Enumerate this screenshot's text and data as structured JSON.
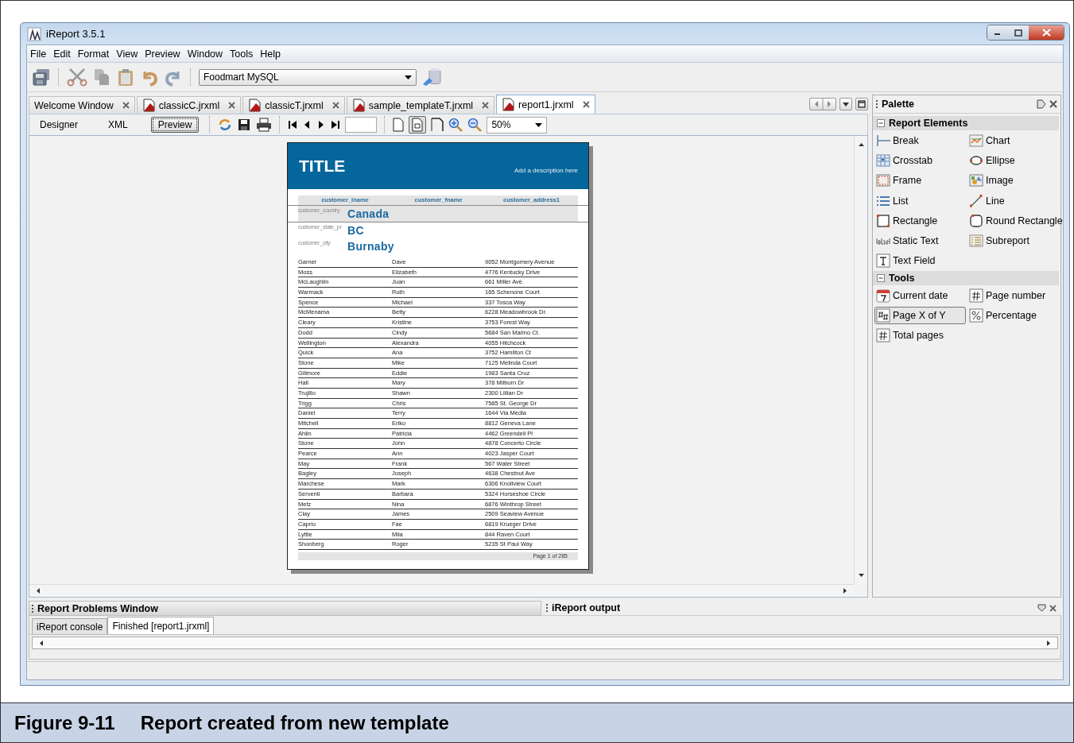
{
  "window": {
    "title": "iReport 3.5.1"
  },
  "menu": [
    "File",
    "Edit",
    "Format",
    "View",
    "Preview",
    "Window",
    "Tools",
    "Help"
  ],
  "toolbar": {
    "datasource": "Foodmart MySQL"
  },
  "editor_tabs": [
    {
      "label": "Welcome Window",
      "kind": "plain",
      "selected": false
    },
    {
      "label": "classicC.jrxml",
      "kind": "report",
      "selected": false
    },
    {
      "label": "classicT.jrxml",
      "kind": "report",
      "selected": false
    },
    {
      "label": "sample_templateT.jrxml",
      "kind": "report",
      "selected": false
    },
    {
      "label": "report1.jrxml",
      "kind": "report",
      "selected": true
    }
  ],
  "view_tabs": [
    {
      "label": "Designer",
      "selected": false
    },
    {
      "label": "XML",
      "selected": false
    },
    {
      "label": "Preview",
      "selected": true
    }
  ],
  "zoom": "50%",
  "report": {
    "title": "TITLE",
    "description": "Add a description here",
    "columns": [
      "customer_lname",
      "customer_fname",
      "customer_address1"
    ],
    "groups": [
      {
        "label": "customer_country",
        "value": "Canada"
      },
      {
        "label": "customer_state_pr",
        "value": "BC"
      },
      {
        "label": "customer_city",
        "value": "Burnaby"
      }
    ],
    "rows": [
      [
        "Garner",
        "Dave",
        "9052 Montgomery Avenue"
      ],
      [
        "Moss",
        "Elizabeth",
        "4776 Kentucky Drive"
      ],
      [
        "McLaughlin",
        "Juan",
        "661 Miller Ave."
      ],
      [
        "Warmack",
        "Ruth",
        "165 Schenone Court"
      ],
      [
        "Spence",
        "Michael",
        "337 Tosca Way"
      ],
      [
        "McMenama",
        "Betty",
        "6228 Meadowbrook Dr."
      ],
      [
        "Cleary",
        "Kristine",
        "3753 Forest Way"
      ],
      [
        "Dodd",
        "Cindy",
        "5684 San Marino Ct."
      ],
      [
        "Wellington",
        "Alexandra",
        "4055 Hitchcock"
      ],
      [
        "Quick",
        "Ana",
        "3752 Hamilton Ct"
      ],
      [
        "Stone",
        "Mike",
        "7125 Melinda Court"
      ],
      [
        "Gillmore",
        "Eddie",
        "1983 Santa Cruz"
      ],
      [
        "Hall",
        "Mary",
        "378 Milburn Dr"
      ],
      [
        "Trujillo",
        "Shawn",
        "2300 Lillian Dr"
      ],
      [
        "Trigg",
        "Chris",
        "7585 St. George Dr"
      ],
      [
        "Daniel",
        "Terry",
        "1644 Via Media"
      ],
      [
        "Mitchell",
        "Eriko",
        "8812 Geneva Lane"
      ],
      [
        "Ahlin",
        "Patricia",
        "4462 Greendell Pl"
      ],
      [
        "Stone",
        "John",
        "4878 Concerto Circle"
      ],
      [
        "Pearce",
        "Ann",
        "4023 Jasper Court"
      ],
      [
        "May",
        "Frank",
        "567 Water Street"
      ],
      [
        "Bagley",
        "Joseph",
        "4638 Chestnut Ave"
      ],
      [
        "Marchese",
        "Mark",
        "6306 Knollview Court"
      ],
      [
        "Serventi",
        "Barbara",
        "5324 Horseshoe Circle"
      ],
      [
        "Metz",
        "Nina",
        "6876 Winthrop Street"
      ],
      [
        "Clay",
        "James",
        "2509 Seaview Avenue"
      ],
      [
        "Caprio",
        "Fae",
        "6819 Krueger Drive"
      ],
      [
        "Lyttle",
        "Mila",
        "844 Raven Court"
      ],
      [
        "Shonberg",
        "Roger",
        "5235 St Paul Way"
      ]
    ],
    "footer": "Page 1 of 285"
  },
  "palette": {
    "title": "Palette",
    "sections": [
      {
        "title": "Report Elements",
        "expanded": true,
        "items": [
          {
            "label": "Break",
            "kind": "break",
            "selected": false
          },
          {
            "label": "Chart",
            "kind": "chart",
            "selected": false
          },
          {
            "label": "Crosstab",
            "kind": "crosstab",
            "selected": false
          },
          {
            "label": "Ellipse",
            "kind": "ellipse",
            "selected": false
          },
          {
            "label": "Frame",
            "kind": "frame",
            "selected": false
          },
          {
            "label": "Image",
            "kind": "image",
            "selected": false
          },
          {
            "label": "List",
            "kind": "list",
            "selected": false
          },
          {
            "label": "Line",
            "kind": "line",
            "selected": false
          },
          {
            "label": "Rectangle",
            "kind": "rectangle",
            "selected": false
          },
          {
            "label": "Round Rectangle",
            "kind": "roundrect",
            "selected": false
          },
          {
            "label": "Static Text",
            "kind": "statictext",
            "selected": false
          },
          {
            "label": "Subreport",
            "kind": "subreport",
            "selected": false
          },
          {
            "label": "Text Field",
            "kind": "textfield",
            "selected": false
          }
        ]
      },
      {
        "title": "Tools",
        "expanded": true,
        "items": [
          {
            "label": "Current date",
            "kind": "date",
            "selected": false
          },
          {
            "label": "Page number",
            "kind": "hash",
            "selected": false
          },
          {
            "label": "Page X of Y",
            "kind": "hashhash",
            "selected": true
          },
          {
            "label": "Percentage",
            "kind": "percent",
            "selected": false
          },
          {
            "label": "Total pages",
            "kind": "hash",
            "selected": false
          }
        ]
      }
    ]
  },
  "bottom": {
    "left_title": "Report Problems Window",
    "right_title": "iReport output",
    "tabs": [
      {
        "label": "iReport console",
        "selected": false
      },
      {
        "label": "Finished [report1.jrxml]",
        "selected": true
      }
    ]
  },
  "caption": {
    "number": "Figure 9-11",
    "text": "Report created from new template"
  }
}
